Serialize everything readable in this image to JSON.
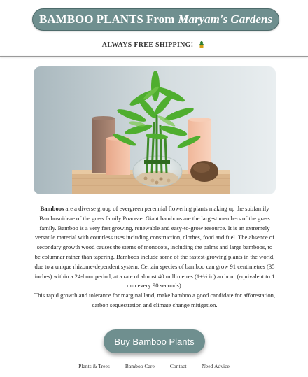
{
  "header": {
    "title_prefix": "BAMBOO PLANTS From",
    "title_brand": "Maryam's Gardens"
  },
  "shipping": {
    "text": "ALWAYS FREE SHIPPING!",
    "icon": "potted-plant-icon"
  },
  "hero": {
    "image_alt": "Lucky bamboo in glass bowl with candles"
  },
  "description": {
    "lead_bold": "Bamboos",
    "p1_rest": " are a diverse group of evergreen perennial flowering plants making up the subfamily Bambusoideae of the grass family Poaceae. Giant bamboos are the largest members of the grass family. Bamboo is a very fast growing, renewable and easy-to-grow resource. It is an extremely versatile material with countless uses including construction, clothes, food and fuel. The absence of secondary growth wood causes the stems of monocots, including the palms and large bamboos, to be columnar rather than tapering. Bamboos include some of the fastest-growing plants in the world, due to a unique rhizome-dependent system. Certain species of bamboo can grow 91 centimetres (35 inches) within a 24-hour period, at a rate of almost 40 millimetres (1+½ in) an hour (equivalent to 1 mm every 90 seconds).",
    "p2": "This rapid growth and tolerance for marginal land, make bamboo a good candidate for afforestation, carbon sequestration and climate change mitigation."
  },
  "cta": {
    "label": "Buy Bamboo Plants"
  },
  "footer": {
    "links": [
      "Plants & Trees",
      "Bamboo Care",
      "Contact",
      "Need Advice"
    ]
  },
  "colors": {
    "accent": "#6f8f8f",
    "accent_border": "#4e6b6b"
  }
}
